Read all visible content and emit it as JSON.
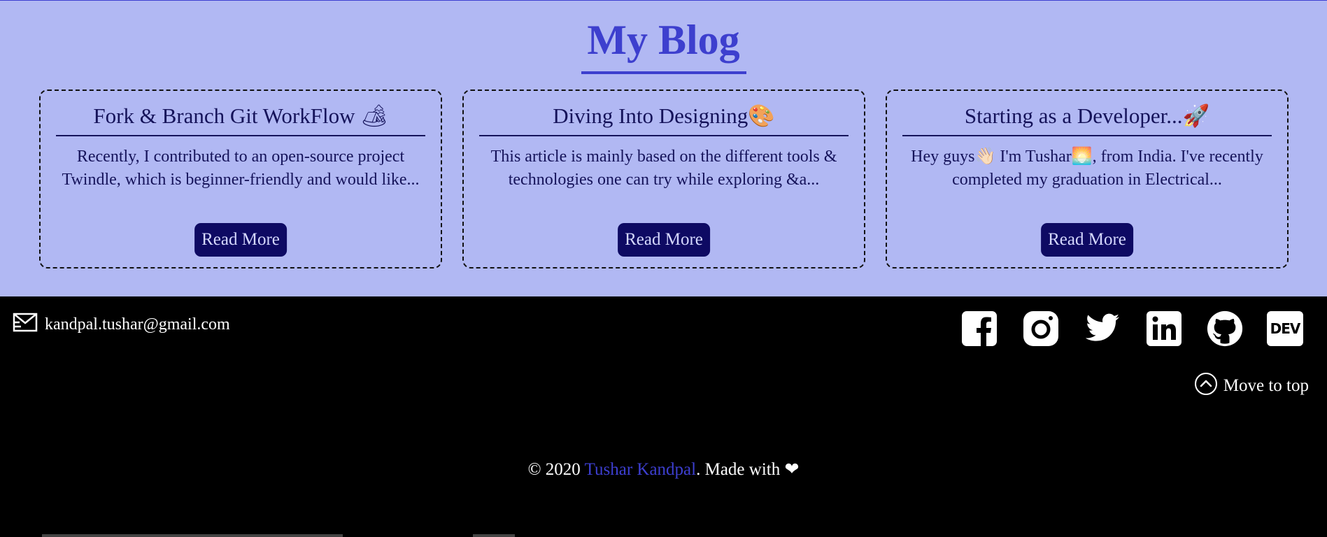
{
  "blog": {
    "title": "My Blog",
    "posts": [
      {
        "title": "Fork & Branch Git WorkFlow 🏕",
        "excerpt": "Recently, I contributed to an open-source project Twindle, which is beginner-friendly and would like...",
        "button": "Read More"
      },
      {
        "title": "Diving Into Designing🎨",
        "excerpt": "This article is mainly based on the different tools & technologies one can try while exploring &a...",
        "button": "Read More"
      },
      {
        "title": "Starting as a Developer...🚀",
        "excerpt": "Hey guys👋🏻 I'm Tushar🌅, from India. I've recently completed my graduation in Electrical...",
        "button": "Read More"
      }
    ]
  },
  "footer": {
    "email": "kandpal.tushar@gmail.com",
    "social_icons": [
      "facebook-icon",
      "instagram-icon",
      "twitter-icon",
      "linkedin-icon",
      "github-icon",
      "dev-icon"
    ],
    "dev_label": "DEV",
    "move_to_top": "Move to top",
    "copyright_prefix": "© 2020 ",
    "author": "Tushar Kandpal",
    "copyright_suffix": ". Made with ",
    "heart": "❤"
  },
  "colors": {
    "section_bg": "#b1b8f3",
    "accent": "#3d3fce",
    "card_text": "#15135a",
    "button_bg": "#0e0a63",
    "footer_bg": "#000000"
  }
}
